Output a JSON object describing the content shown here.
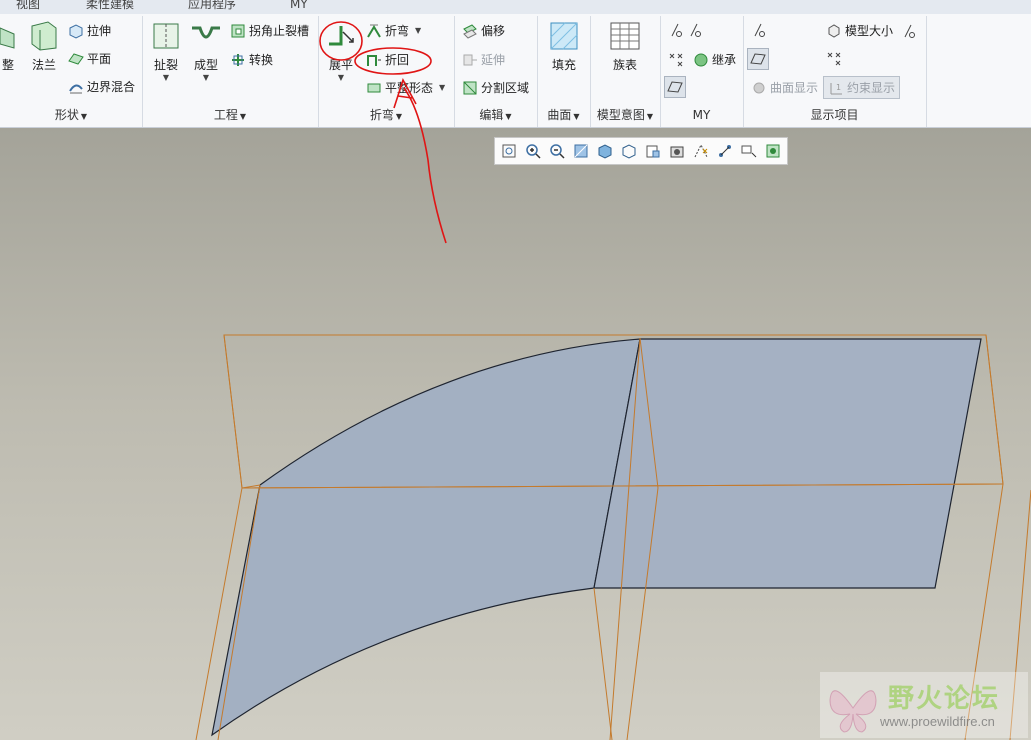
{
  "tabs": [
    "视图",
    "柔性建模",
    "应用程序",
    "MY"
  ],
  "groups": {
    "shape": {
      "label": "形状",
      "big": [
        "整",
        "法兰"
      ],
      "small": [
        "拉伸",
        "平面",
        "边界混合"
      ]
    },
    "engineering": {
      "label": "工程",
      "big": [
        "扯裂",
        "成型"
      ],
      "small": [
        "拐角止裂槽",
        "转换"
      ]
    },
    "bend": {
      "label": "折弯",
      "big": "展平",
      "small": [
        "折弯",
        "折回",
        "平整形态"
      ]
    },
    "edit": {
      "label": "编辑",
      "small": [
        "偏移",
        "延伸",
        "分割区域"
      ]
    },
    "surface": {
      "label": "曲面",
      "big": "填充"
    },
    "model_intent": {
      "label": "模型意图",
      "big": "族表"
    },
    "my": {
      "label": "MY",
      "small": [
        "继承"
      ]
    },
    "display": {
      "label": "显示项目",
      "small": [
        "模型大小",
        "曲面显示",
        "约束显示"
      ]
    }
  },
  "view_toolbar": {
    "icons": [
      "refit-icon",
      "zoom-in-icon",
      "zoom-out-icon",
      "repaint-icon",
      "display-style-icon",
      "saved-views-icon",
      "view-manager-icon",
      "perspective-icon",
      "datum-display-icon",
      "spin-center-icon",
      "annotation-display-icon",
      "appearance-icon"
    ]
  },
  "watermark": {
    "title": "野火论坛",
    "url": "www.proewildfire.cn"
  },
  "colors": {
    "surface_fill": "#a3b0c2",
    "bounding_box": "#c47a2c",
    "annotation": "#e01515",
    "accent_green": "#2f8a3c"
  }
}
